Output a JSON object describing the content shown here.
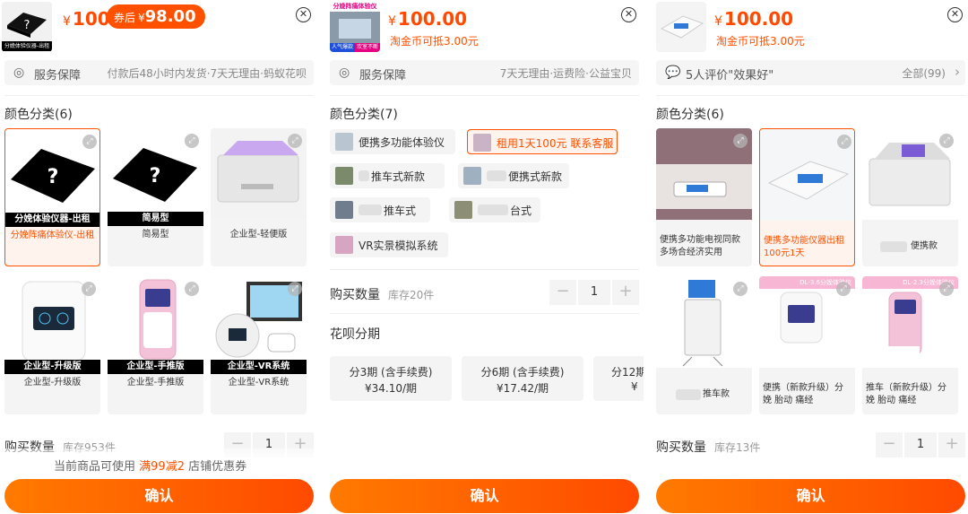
{
  "panel1": {
    "thumb_caption": "分娩体验仪器-出租",
    "price_symbol": "¥",
    "price": "100",
    "coupon_prefix": "券后",
    "coupon_symbol": "¥",
    "coupon_price": "98.00",
    "service_label": "服务保障",
    "service_text": "付款后48小时内发货·7天无理由·蚂蚁花呗",
    "color_title": "颜色分类(6)",
    "variants": [
      {
        "tag": "分娩体验仪器-出租",
        "label": "分娩阵痛体验仪-出租"
      },
      {
        "tag": "简易型",
        "label": "简易型"
      },
      {
        "tag": "",
        "label": "企业型-轻便版"
      },
      {
        "tag": "企业型-升级版",
        "label": "企业型-升级版"
      },
      {
        "tag": "企业型-手推版",
        "label": "企业型-手推版"
      },
      {
        "tag": "企业型-VR系统",
        "label": "企业型-VR系统"
      }
    ],
    "qty_label": "购买数量",
    "stock": "库存953件",
    "qty": "1",
    "notice_pre": "当前商品可使用",
    "notice_hl": "满99减2",
    "notice_post": "店铺优惠券",
    "confirm": "确认"
  },
  "panel2": {
    "thumb_caption": "分娩阵痛体验仪",
    "thumb_badge1": "人气爆款",
    "thumb_badge2": "欢室不断",
    "price_symbol": "¥",
    "price": "100.00",
    "sub": "淘金币可抵3.00元",
    "service_label": "服务保障",
    "service_text": "7天无理由·运费险·公益宝贝",
    "color_title": "颜色分类(7)",
    "chips": [
      {
        "label": "便携多功能体验仪"
      },
      {
        "label": "租用1天100元 联系客服"
      },
      {
        "label": "推车式新款"
      },
      {
        "label": "便携式新款"
      },
      {
        "label": "推车式"
      },
      {
        "label": "台式"
      },
      {
        "label": "VR实景模拟系统"
      }
    ],
    "qty_label": "购买数量",
    "stock": "库存20件",
    "qty": "1",
    "installment_title": "花呗分期",
    "installments": [
      {
        "term": "分3期 (含手续费)",
        "amount": "¥34.10/期"
      },
      {
        "term": "分6期 (含手续费)",
        "amount": "¥17.42/期"
      },
      {
        "term": "分12期",
        "amount": "¥"
      }
    ],
    "confirm": "确认"
  },
  "panel3": {
    "price_symbol": "¥",
    "price": "100.00",
    "sub": "淘金币可抵3.00元",
    "review_text": "5人评价\"效果好\"",
    "review_all": "全部(99)",
    "color_title": "颜色分类(6)",
    "variants": [
      {
        "label": "便携多功能电视同款 多场合经济实用"
      },
      {
        "label": "便携多功能仪器出租 100元1天"
      },
      {
        "label": "便携款"
      },
      {
        "label": "推车款"
      },
      {
        "label": "便携（新款升级）分娩 胎动 痛经",
        "band": "DL-3.6分娩体验仪"
      },
      {
        "label": "推车（新款升级）分娩 胎动 痛经",
        "band": "DL-2.3分娩体验仪"
      }
    ],
    "qty_label": "购买数量",
    "stock": "库存13件",
    "qty": "1",
    "confirm": "确认"
  },
  "icons": {
    "close": "close-icon",
    "shield": "shield-icon",
    "chat": "chat-icon",
    "expand": "expand-icon",
    "chevron": "chevron-right-icon"
  },
  "colors": {
    "accent": "#ff5000",
    "price": "#ff4a00",
    "chip_bg": "#f4f4f4",
    "selected_bg": "#fff3ee"
  }
}
